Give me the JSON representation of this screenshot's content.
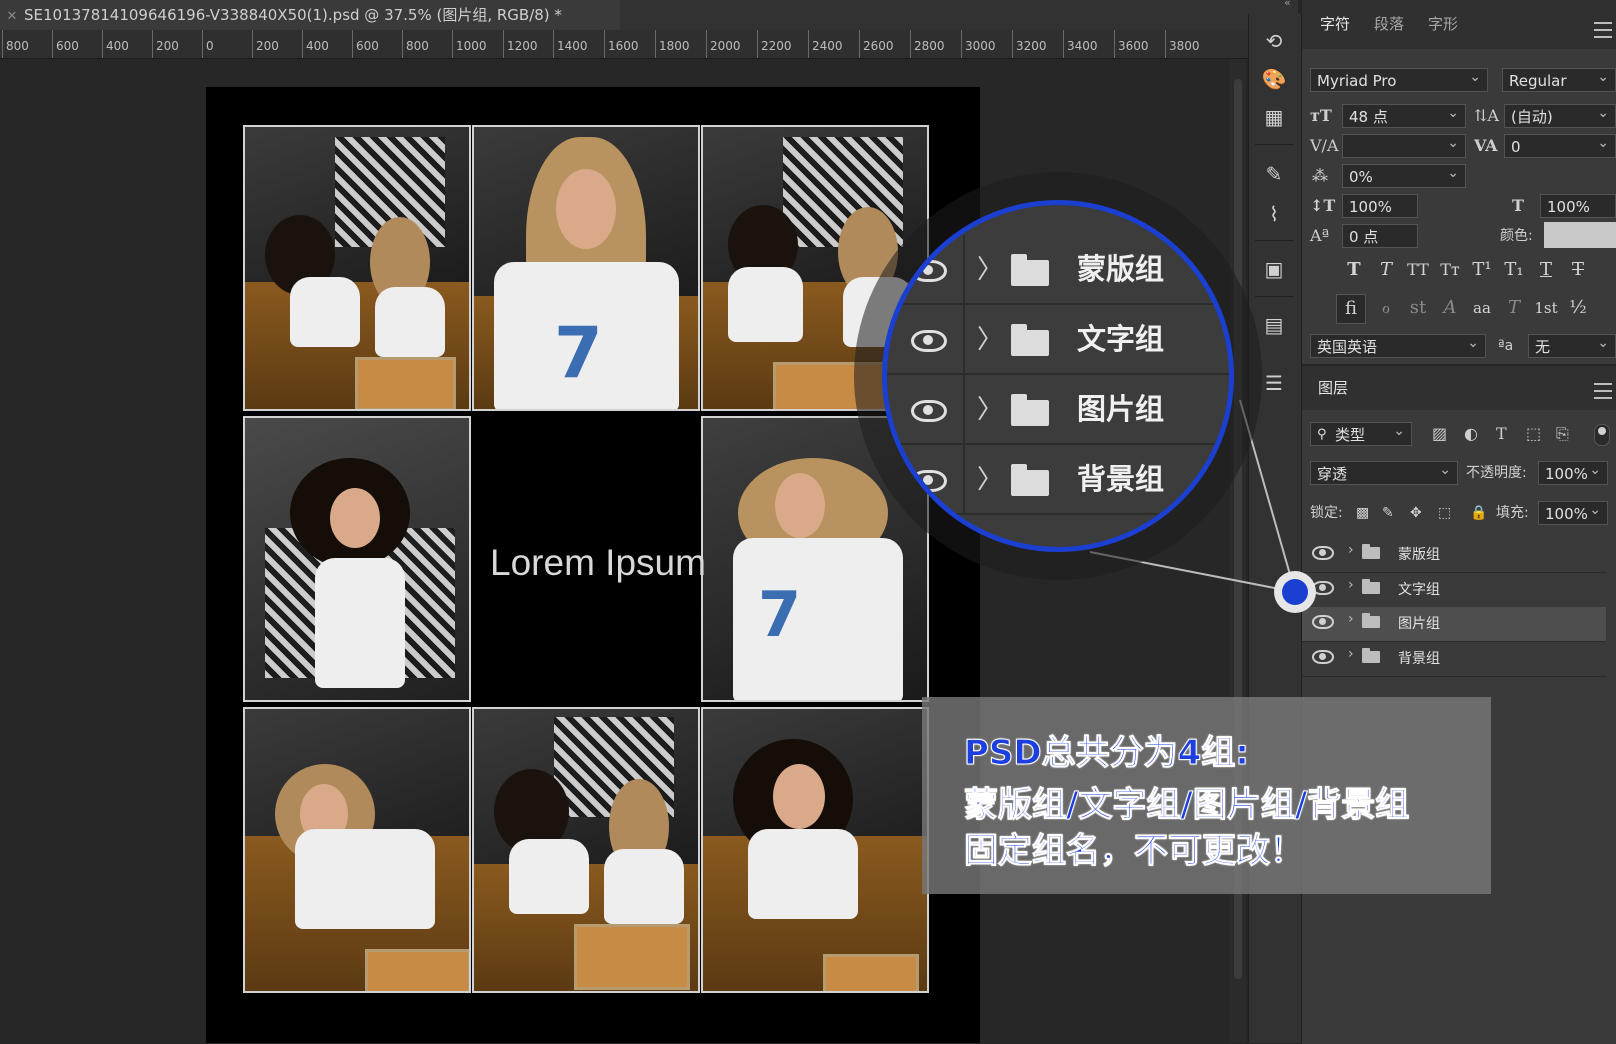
{
  "document": {
    "tab_title": "SE10137814109646196-V338840X50(1).psd @ 37.5% (图片组, RGB/8) *",
    "canvas_text": "Lorem Ipsum"
  },
  "ruler": {
    "ticks": [
      "800",
      "600",
      "400",
      "200",
      "0",
      "200",
      "400",
      "600",
      "800",
      "1000",
      "1200",
      "1400",
      "1600",
      "1800",
      "2000",
      "2200",
      "2400",
      "2600",
      "2800",
      "3000",
      "3200",
      "3400",
      "3600",
      "3800"
    ]
  },
  "character_panel": {
    "tabs": [
      "字符",
      "段落",
      "字形"
    ],
    "active_tab": "字符",
    "font_family": "Myriad Pro",
    "font_style": "Regular",
    "font_size": "48 点",
    "leading": "(自动)",
    "kerning": "",
    "tracking": "0",
    "tsume": "0%",
    "vertical_scale": "100%",
    "horizontal_scale": "100%",
    "baseline_shift": "0 点",
    "color_label": "颜色:",
    "color": "#c8c8c8",
    "language": "英国英语",
    "antialias_label": "ªa",
    "antialias": "无",
    "style_buttons": [
      "T",
      "T",
      "TT",
      "Tт",
      "T¹",
      "T₁",
      "T",
      "T"
    ],
    "opentype_buttons": [
      "fi",
      "ℴ",
      "st",
      "A",
      "aa",
      "T",
      "1st",
      "½"
    ]
  },
  "layers_panel": {
    "tab": "图层",
    "filter_label": "类型",
    "blend_mode": "穿透",
    "opacity_label": "不透明度:",
    "opacity": "100%",
    "lock_label": "锁定:",
    "fill_label": "填充:",
    "fill": "100%",
    "layers": [
      {
        "name": "蒙版组",
        "selected": false
      },
      {
        "name": "文字组",
        "selected": false
      },
      {
        "name": "图片组",
        "selected": true
      },
      {
        "name": "背景组",
        "selected": false
      }
    ]
  },
  "callout": {
    "groups": [
      "蒙版组",
      "文字组",
      "图片组",
      "背景组"
    ],
    "note_lines": [
      "PSD总共分为4组:",
      "蒙版组/文字组/图片组/背景组",
      "固定组名，不可更改！"
    ],
    "accent_color": "#1b3fd0"
  }
}
